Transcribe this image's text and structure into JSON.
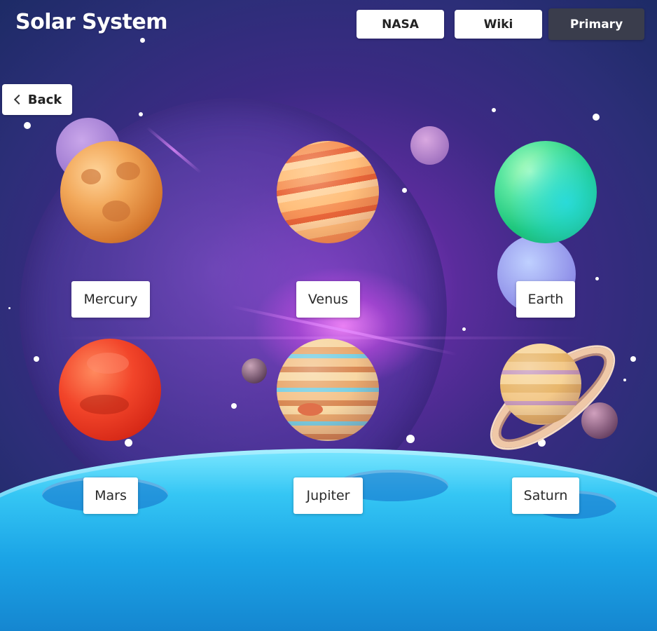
{
  "header": {
    "title": "Solar System",
    "nav": [
      {
        "label": "NASA",
        "active": false
      },
      {
        "label": "Wiki",
        "active": false
      },
      {
        "label": "Primary",
        "active": true
      }
    ]
  },
  "back": {
    "label": "Back",
    "icon": "chevron-left-icon"
  },
  "planets": [
    {
      "name": "Mercury"
    },
    {
      "name": "Venus"
    },
    {
      "name": "Earth"
    },
    {
      "name": "Mars"
    },
    {
      "name": "Jupiter"
    },
    {
      "name": "Saturn"
    }
  ],
  "colors": {
    "active_button": "#3a3d4c",
    "button": "#ffffff",
    "title_text": "#ffffff"
  }
}
